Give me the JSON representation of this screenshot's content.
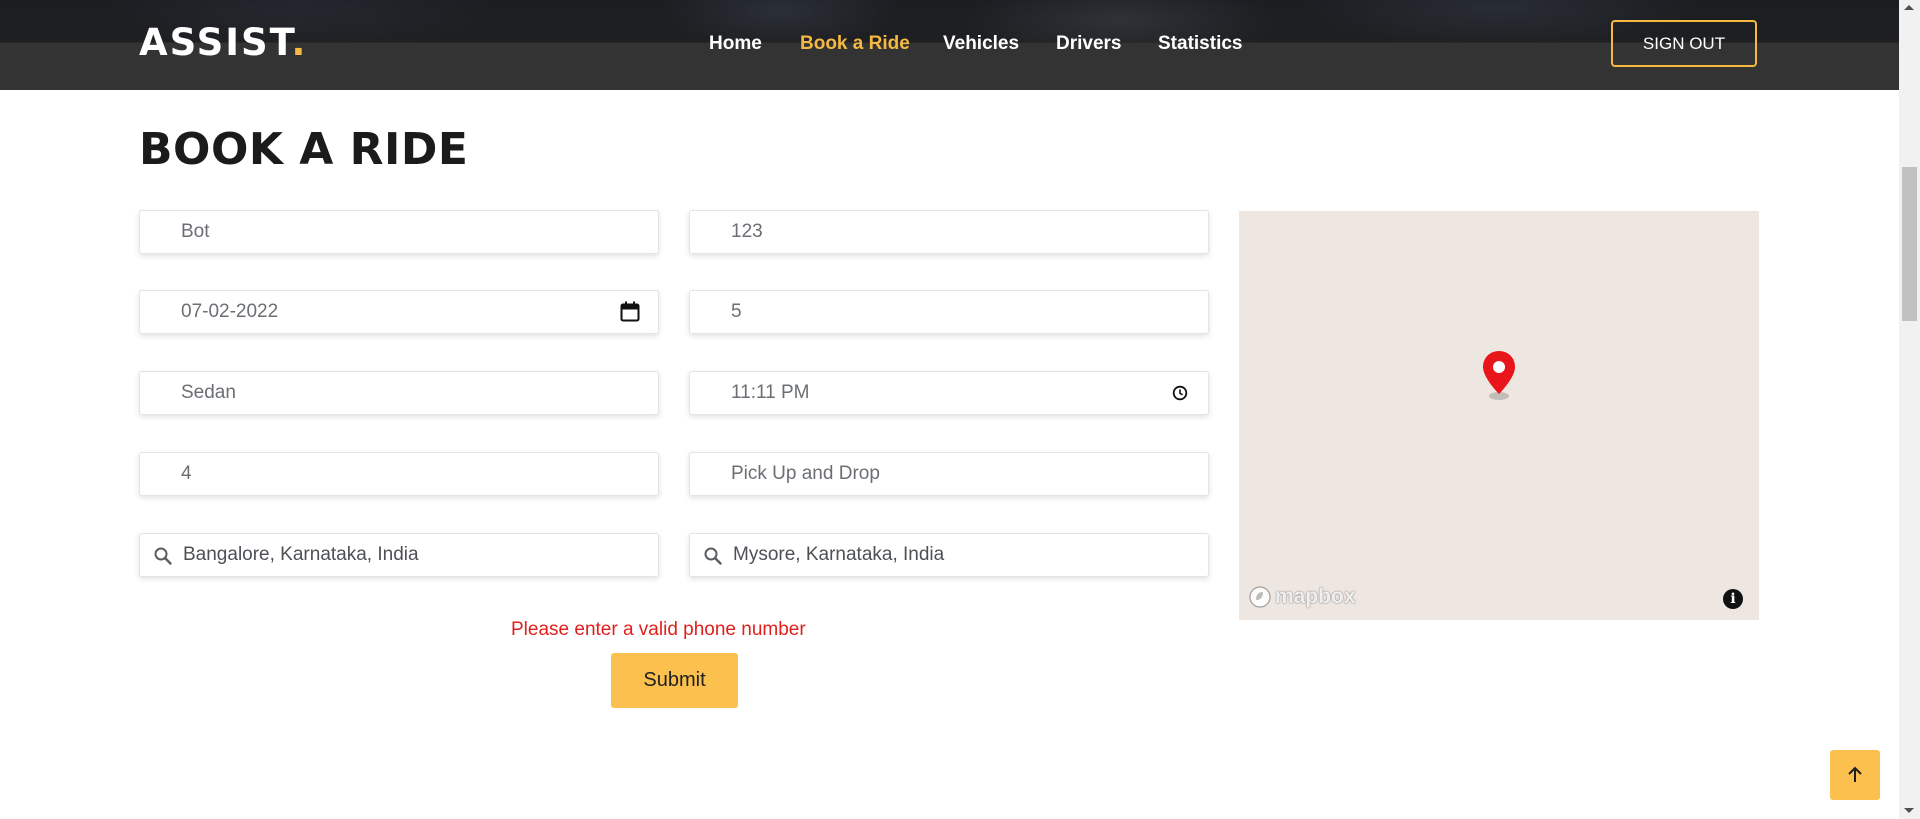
{
  "header": {
    "logo_text": "ASSIST",
    "logo_dot": ".",
    "nav": [
      {
        "label": "Home",
        "active": false
      },
      {
        "label": "Book a Ride",
        "active": true
      },
      {
        "label": "Vehicles",
        "active": false
      },
      {
        "label": "Drivers",
        "active": false
      },
      {
        "label": "Statistics",
        "active": false
      }
    ],
    "signout_label": "SIGN OUT"
  },
  "page_title": "BOOK A RIDE",
  "form": {
    "name": "Bot",
    "phone": "123",
    "date": "07-02-2022",
    "duration": "5",
    "vehicle_type": "Sedan",
    "time": "11:11  PM",
    "passengers": "4",
    "ride_type": "Pick Up and Drop",
    "pickup_location": "Bangalore, Karnataka, India",
    "drop_location": "Mysore, Karnataka, India",
    "error_message": "Please enter a valid phone number",
    "submit_label": "Submit"
  },
  "map": {
    "attribution_logo": "mapbox",
    "info_glyph": "i",
    "marker_icon": "map-pin-icon"
  },
  "scroll_to_top_icon": "arrow-up-icon",
  "colors": {
    "accent": "#f5b942",
    "button": "#fbc04e",
    "header": "#333333",
    "error": "#e0201c",
    "map_background": "#eee7e1",
    "marker": "#e8151b"
  }
}
